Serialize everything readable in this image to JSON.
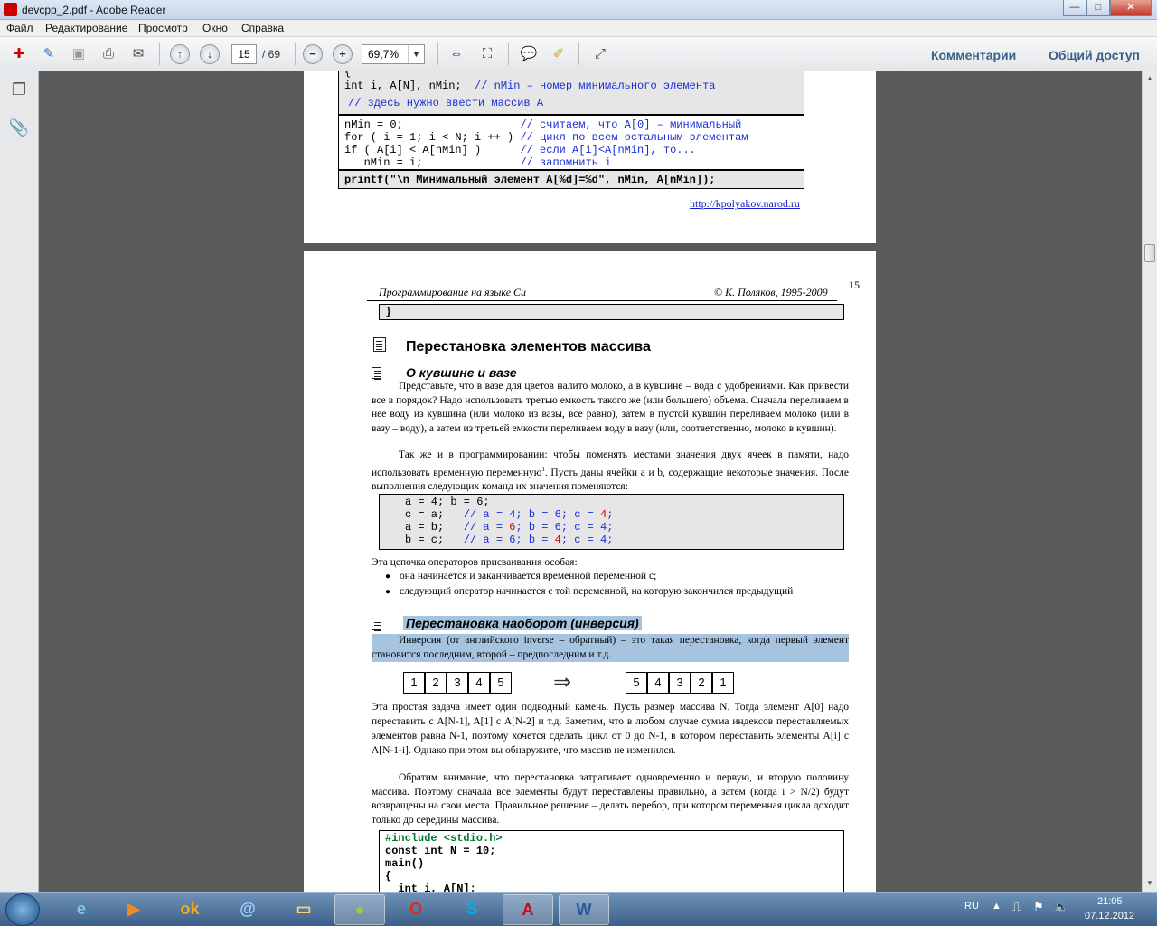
{
  "window": {
    "title": "devcpp_2.pdf - Adobe Reader",
    "minimize": "—",
    "maximize": "□",
    "close": "✕"
  },
  "menu": [
    "Файл",
    "Редактирование",
    "Просмотр",
    "Окно",
    "Справка"
  ],
  "toolbar": {
    "page_current": "15",
    "page_total": "/ 69",
    "zoom": "69,7%",
    "zoom_dropdown": "▼",
    "comments_label": "Комментарии",
    "share_label": "Общий доступ",
    "icons": [
      "create-pdf-icon",
      "edit-icon",
      "save-icon",
      "print-icon",
      "email-icon",
      "page-up-icon",
      "page-down-icon",
      "zoom-out-icon",
      "zoom-in-icon",
      "fit-width-icon",
      "fit-page-icon",
      "comment-icon",
      "highlight-icon",
      "full-screen-icon"
    ]
  },
  "nav_pane": {
    "icons": [
      "pages-icon",
      "attachments-icon"
    ]
  },
  "page1": {
    "header_line": "{",
    "decl_code": "int i, A[N], nMin;",
    "decl_comment": "// nMin – номер минимального элемента",
    "input_comment": "// здесь нужно ввести массив A",
    "loop_lines": [
      {
        "code": "nMin = 0;                  ",
        "comment": "// считаем, что A[0] – минимальный"
      },
      {
        "code": "for ( i = 1; i < N; i ++ ) ",
        "comment": "// цикл по всем остальным элементам"
      },
      {
        "code": "if ( A[i] < A[nMin] )      ",
        "comment": "// если A[i]<A[nMin], то..."
      },
      {
        "code": "   nMin = i;               ",
        "comment": "// запомнить i"
      }
    ],
    "printf_line": "printf(\"\\n Минимальный элемент A[%d]=%d\", nMin, A[nMin]);",
    "url": "http://kpolyakov.narod.ru"
  },
  "page2": {
    "page_number": "15",
    "header_left": "Программирование на языке Си",
    "header_right": "© К. Поляков, 1995-2009",
    "closing_brace": "}",
    "section_title": "Перестановка элементов массива",
    "sub1_title": "О кувшине и вазе",
    "para1": "Представьте, что в вазе для цветов налито молоко, а в кувшине – вода с удобрениями. Как привести все в порядок? Надо использовать третью емкость такого же (или большего) объема. Сначала переливаем в нее воду из кувшина (или молоко из вазы, все равно), затем в пустой кувшин переливаем молоко (или в вазу – воду), а затем из третьей емкости переливаем воду в вазу (или, соответственно, молоко в кувшин).",
    "para2a": "Так же и в программировании: чтобы поменять местами значения двух ячеек в памяти, надо использовать временную переменную",
    "para2_sup": "1",
    "para2b": ". Пусть даны ячейки a и b, содержащие некоторые значения. После выполнения следующих команд их значения поменяются:",
    "swap_code": [
      {
        "code": "a = 4; b = 6;",
        "parts": []
      },
      {
        "code": "c = a;   ",
        "parts": [
          "// a = 4; b = 6; c = ",
          "4",
          ";"
        ]
      },
      {
        "code": "a = b;   ",
        "parts": [
          "// a = ",
          "6",
          "; b = 6; c = 4;"
        ]
      },
      {
        "code": "b = c;   ",
        "parts": [
          "// a = 6; b = ",
          "4",
          "; c = 4;"
        ]
      }
    ],
    "chain_intro": "Эта цепочка операторов присваивания особая:",
    "bullets": [
      "она начинается и заканчивается временной переменной c;",
      "следующий оператор начинается с той переменной, на которую закончился предыдущий"
    ],
    "sub2_title": "Перестановка наоборот (инверсия)",
    "inversion_text": "Инверсия (от английского inverse – обратный) – это такая перестановка, когда первый элемент становится последним, второй – предпоследним и т.д.",
    "array_before": [
      "1",
      "2",
      "3",
      "4",
      "5"
    ],
    "array_after": [
      "5",
      "4",
      "3",
      "2",
      "1"
    ],
    "arrow": "⇒",
    "para3": "Эта простая задача имеет один подводный камень. Пусть размер массива N. Тогда элемент A[0] надо переставить с A[N-1], A[1] с A[N-2] и т.д. Заметим, что в любом случае сумма индексов переставляемых элементов равна N-1, поэтому хочется сделать цикл от 0 до N-1, в котором переставить элементы A[i] с A[N-1-i]. Однако при этом вы обнаружите, что массив не изменился.",
    "para4": "Обратим внимание, что перестановка затрагивает одновременно и первую, и вторую половину массива. Поэтому сначала все элементы будут переставлены правильно, а затем (когда i > N/2) будут возвращены на свои места. Правильное решение – делать перебор, при котором переменная цикла доходит только до середины массива.",
    "code2": [
      "#include <stdio.h>",
      "const int N = 10;",
      "main()",
      "{",
      "  int i, A[N];"
    ]
  },
  "taskbar": {
    "apps": [
      "windows-start-icon",
      "ie-icon",
      "media-player-icon",
      "odnoklassniki-icon",
      "browser-at-icon",
      "explorer-folder-icon",
      "app-ball-icon",
      "opera-icon",
      "skype-icon",
      "adobe-reader-icon",
      "word-icon"
    ],
    "lang": "RU",
    "time": "21:05",
    "date": "07.12.2012"
  },
  "colors": {
    "code_comment": "#1a2ed6",
    "code_highlight_red": "#d00000",
    "selection": "#a6c3e0",
    "accent_link": "#3a5f8a"
  }
}
